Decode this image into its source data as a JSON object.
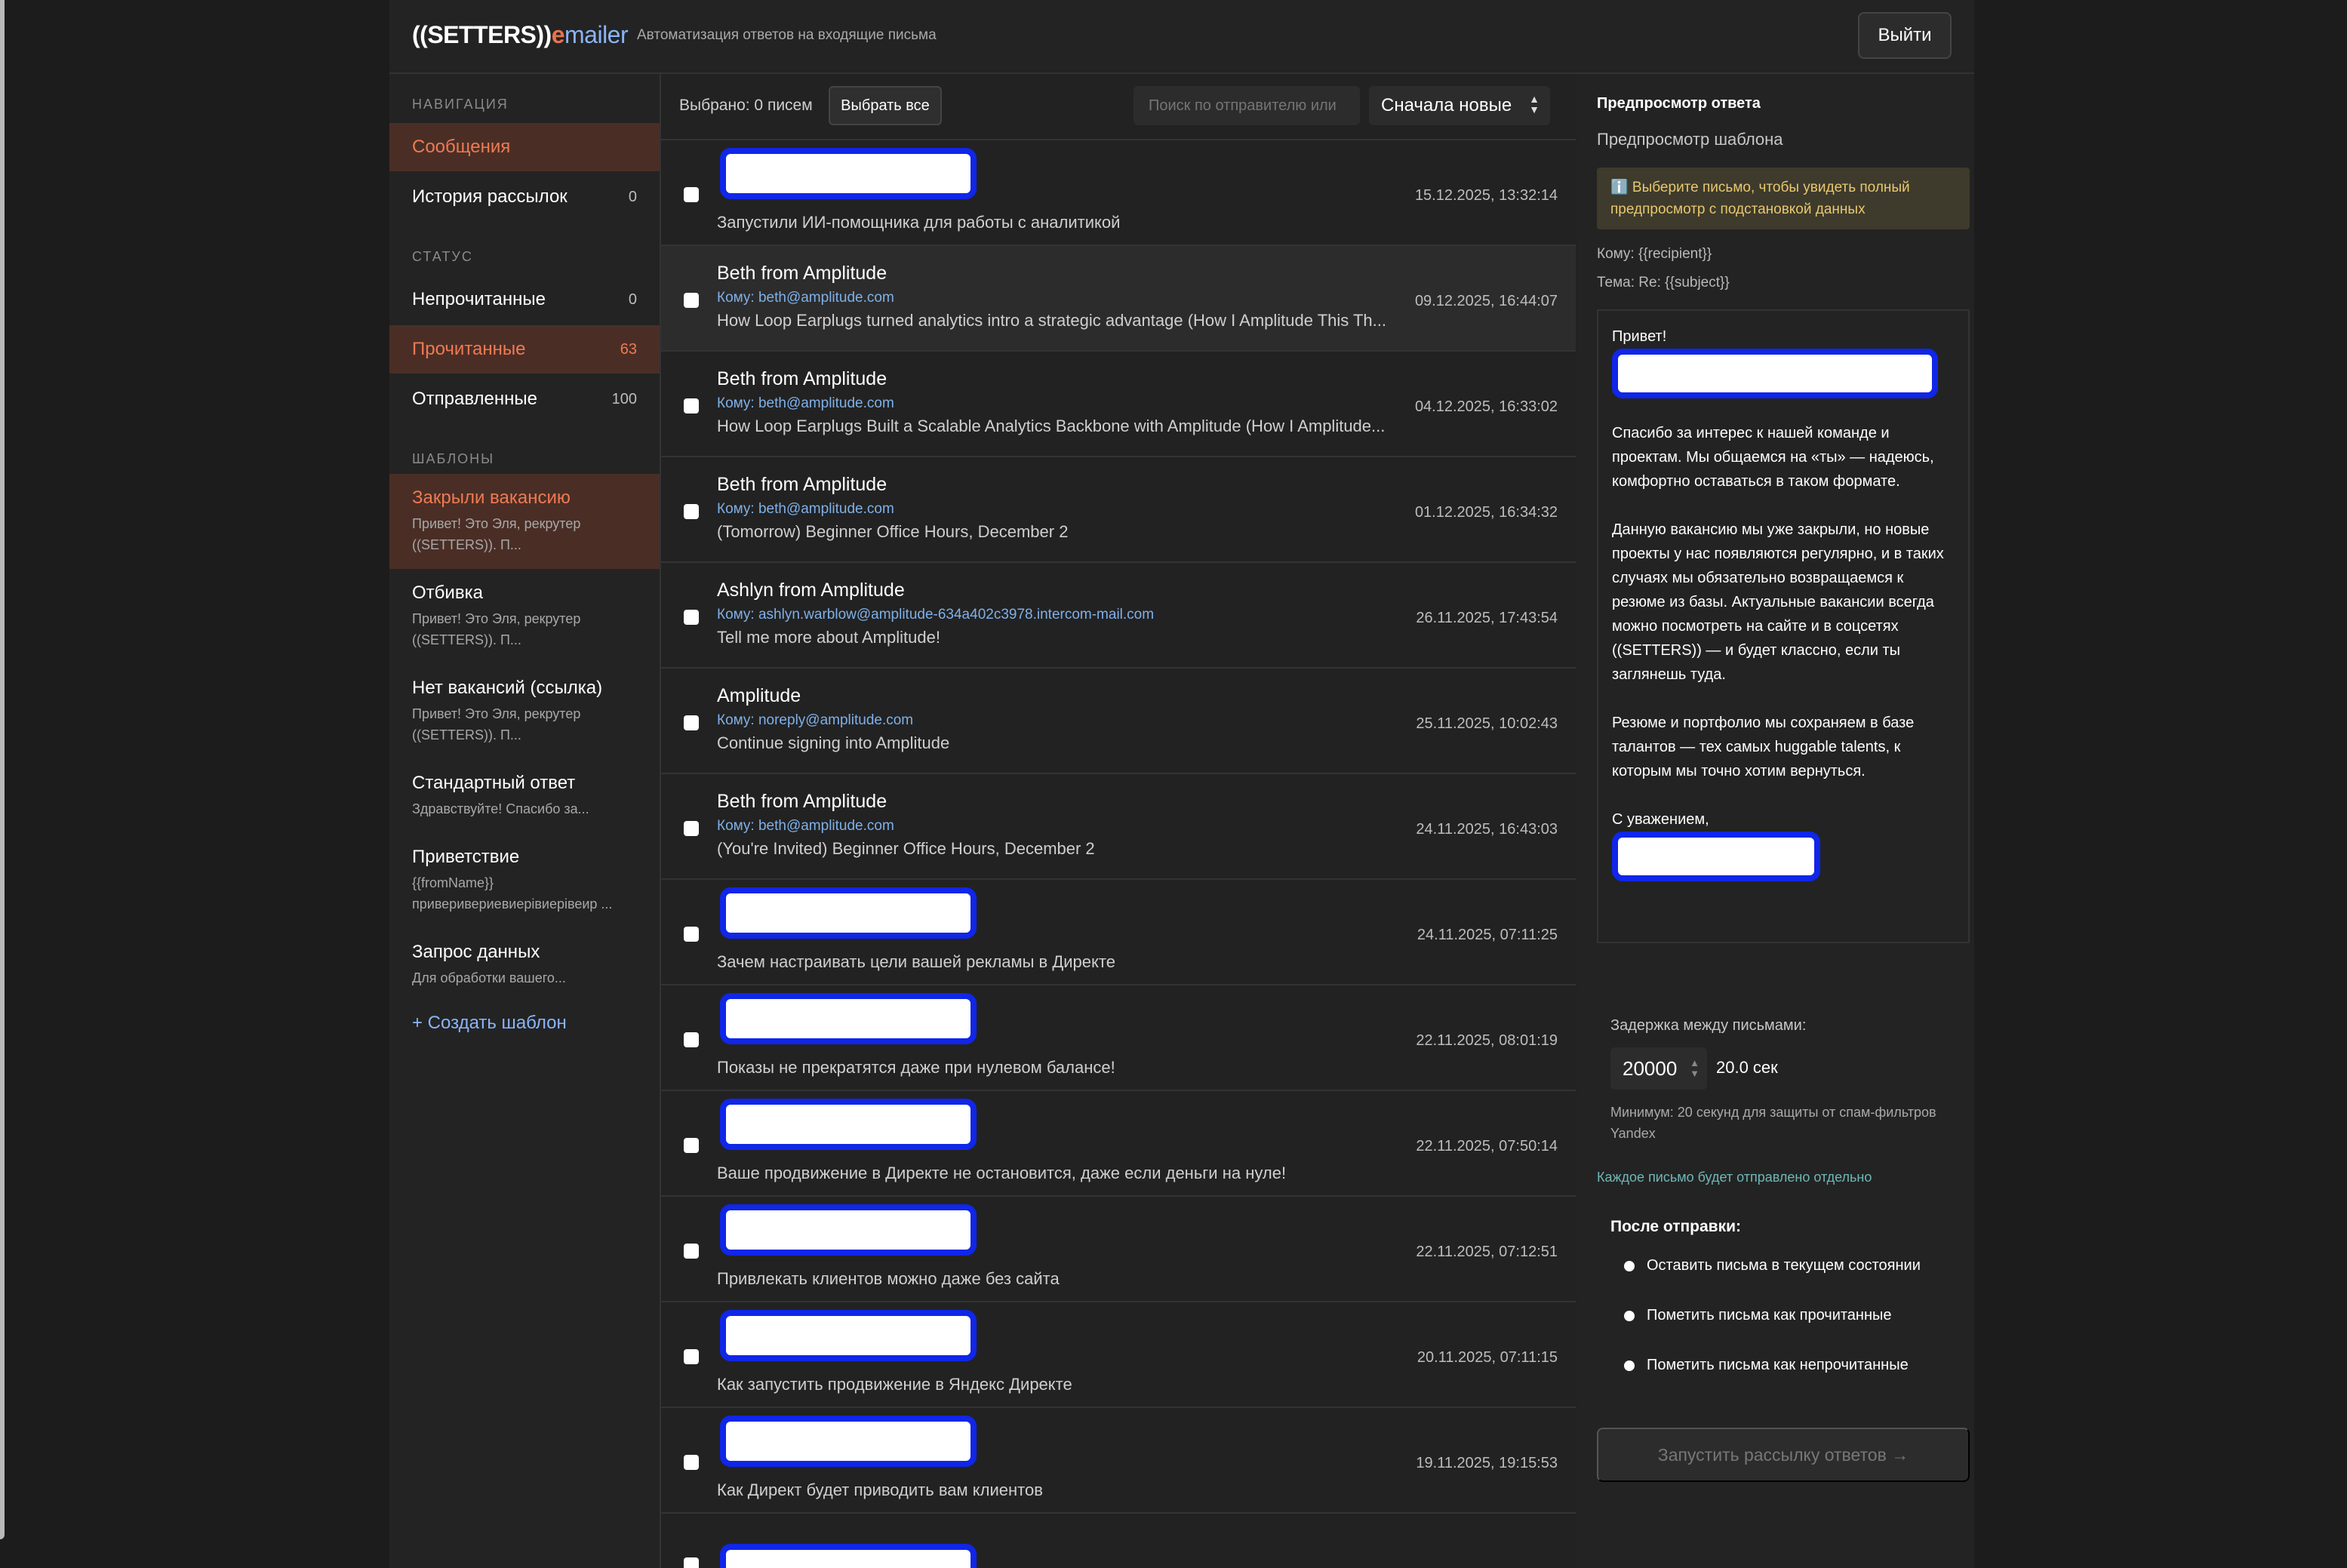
{
  "header": {
    "logo_main": "((SETTERS))",
    "logo_e": "e",
    "logo_rest": "mailer",
    "subtitle": "Автоматизация ответов на входящие письма",
    "logout": "Выйти"
  },
  "sidebar": {
    "nav_title": "НАВИГАЦИЯ",
    "messages": "Сообщения",
    "history": "История рассылок",
    "history_count": "0",
    "status_title": "СТАТУС",
    "unread": "Непрочитанные",
    "unread_count": "0",
    "read": "Прочитанные",
    "read_count": "63",
    "sent": "Отправленные",
    "sent_count": "100",
    "templates_title": "ШАБЛОНЫ",
    "templates": [
      {
        "name": "Закрыли вакансию",
        "desc": "Привет! Это Эля, рекрутер ((SETTERS)). П..."
      },
      {
        "name": "Отбивка",
        "desc": "Привет! Это Эля, рекрутер ((SETTERS)). П..."
      },
      {
        "name": "Нет вакансий (ссылка)",
        "desc": "Привет! Это Эля, рекрутер ((SETTERS)). П..."
      },
      {
        "name": "Стандартный ответ",
        "desc": "Здравствуйте! Спасибо за..."
      },
      {
        "name": "Приветствие",
        "desc": "{{fromName}} приверивериевиерiвиерiвеир ..."
      },
      {
        "name": "Запрос данных",
        "desc": "Для обработки вашего..."
      }
    ],
    "create_template": "+ Создать шаблон"
  },
  "list": {
    "selected": "Выбрано: 0 писем",
    "select_all": "Выбрать все",
    "search_placeholder": "Поиск по отправителю или",
    "sort": "Сначала новые",
    "rows": [
      {
        "sender": "",
        "to": "",
        "subject": "Запустили ИИ-помощника для работы с аналитикой",
        "date": "15.12.2025, 13:32:14"
      },
      {
        "sender": "Beth from Amplitude",
        "to": "Кому: beth@amplitude.com",
        "subject": "How Loop Earplugs turned analytics intro a strategic advantage (How I Amplitude This Th...",
        "date": "09.12.2025, 16:44:07"
      },
      {
        "sender": "Beth from Amplitude",
        "to": "Кому: beth@amplitude.com",
        "subject": "How Loop Earplugs Built a Scalable Analytics Backbone with Amplitude (How I Amplitude...",
        "date": "04.12.2025, 16:33:02"
      },
      {
        "sender": "Beth from Amplitude",
        "to": "Кому: beth@amplitude.com",
        "subject": "(Tomorrow) Beginner Office Hours, December 2",
        "date": "01.12.2025, 16:34:32"
      },
      {
        "sender": "Ashlyn from Amplitude",
        "to": "Кому: ashlyn.warblow@amplitude-634a402c3978.intercom-mail.com",
        "subject": "Tell me more about Amplitude!",
        "date": "26.11.2025, 17:43:54"
      },
      {
        "sender": "Amplitude",
        "to": "Кому: noreply@amplitude.com",
        "subject": "Continue signing into Amplitude",
        "date": "25.11.2025, 10:02:43"
      },
      {
        "sender": "Beth from Amplitude",
        "to": "Кому: beth@amplitude.com",
        "subject": "(You're Invited) Beginner Office Hours, December 2",
        "date": "24.11.2025, 16:43:03"
      },
      {
        "sender": "",
        "to": "",
        "subject": "Зачем настраивать цели вашей рекламы в Директе",
        "date": "24.11.2025, 07:11:25"
      },
      {
        "sender": "",
        "to": "",
        "subject": "Показы не прекратятся даже при нулевом балансе!",
        "date": "22.11.2025, 08:01:19"
      },
      {
        "sender": "",
        "to": "",
        "subject": "Ваше продвижение в Директе не остановится, даже если деньги на нуле!",
        "date": "22.11.2025, 07:50:14"
      },
      {
        "sender": "",
        "to": "",
        "subject": "Привлекать клиентов можно даже без сайта",
        "date": "22.11.2025, 07:12:51"
      },
      {
        "sender": "",
        "to": "",
        "subject": "Как запустить продвижение в Яндекс Директе",
        "date": "20.11.2025, 07:11:15"
      },
      {
        "sender": "",
        "to": "",
        "subject": "Как Директ будет приводить вам клиентов",
        "date": "19.11.2025, 19:15:53"
      }
    ]
  },
  "preview": {
    "title": "Предпросмотр ответа",
    "subtitle": "Предпросмотр шаблона",
    "info": "ℹ️ Выберите письмо, чтобы увидеть полный предпросмотр с подстановкой данных",
    "to": "Кому: {{recipient}}",
    "subject": "Тема: Re: {{subject}}",
    "greeting": "Привет!",
    "p1": "Спасибо за интерес к нашей команде и проектам. Мы общаемся на «ты» — надеюсь, комфортно оставаться в таком формате.",
    "p2": "Данную вакансию мы уже закрыли, но новые проекты у нас появляются регулярно, и в таких случаях мы обязательно возвращаемся к резюме из базы. Актуальные вакансии всегда можно посмотреть на сайте и в соцсетях ((SETTERS)) — и будет классно, если ты заглянешь туда.",
    "p3": "Резюме и портфолио мы сохраняем в базе талантов — тех самых huggable talents, к которым мы точно хотим вернуться.",
    "sign": "С уважением,",
    "delay_label": "Задержка между письмами:",
    "delay_value": "20000",
    "delay_sec": "20.0 сек",
    "delay_hint": "Минимум: 20 секунд для защиты от спам-фильтров Yandex",
    "each_note": "Каждое письмо будет отправлено отдельно",
    "after_title": "После отправки:",
    "options": [
      "Оставить письма в текущем состоянии",
      "Пометить письма как прочитанные",
      "Пометить письма как непрочитанные"
    ],
    "launch": "Запустить рассылку ответов →"
  }
}
